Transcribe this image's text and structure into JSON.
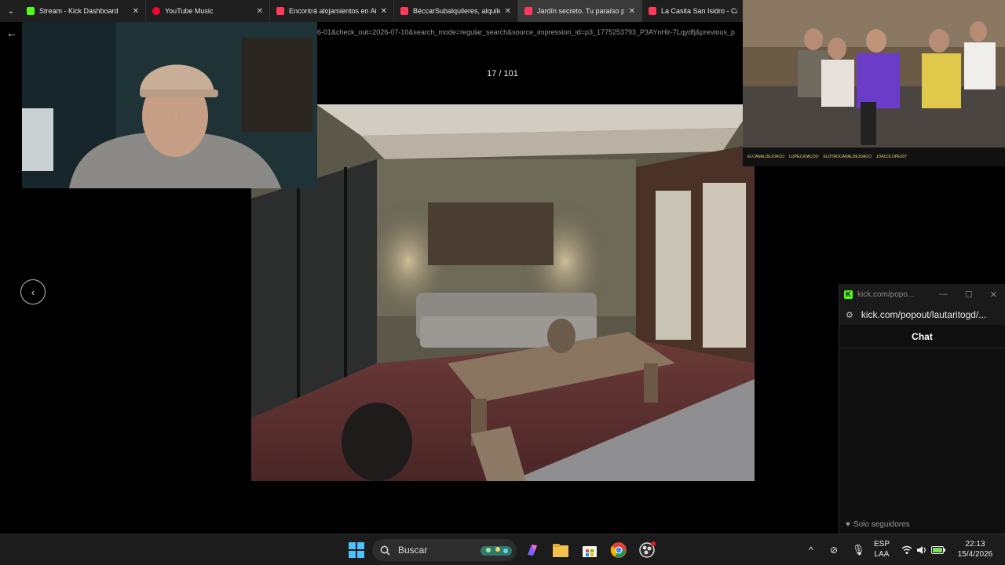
{
  "tabs": [
    {
      "title": "Stream - Kick Dashboard",
      "favicon_color": "#53fc18",
      "active": false
    },
    {
      "title": "YouTube Music",
      "favicon_color": "#ff0033",
      "active": false
    },
    {
      "title": "Encontrá alojamientos en Airbnb",
      "favicon_color": "#ff385c",
      "active": false
    },
    {
      "title": "BéccarSubalquileres, alquileres",
      "favicon_color": "#ff385c",
      "active": false
    },
    {
      "title": "Jardín secreto. Tu paraíso priva",
      "favicon_color": "#ff385c",
      "active": true
    },
    {
      "title": "La Casita San Isidro - Casas en",
      "favicon_color": "#ff385c",
      "active": false
    }
  ],
  "address": {
    "url_fragment": "6-01&check_out=2026-07-10&search_mode=regular_search&source_impression_id=p3_1775253793_P3AYnHlr-7Lqydfj&previous_p"
  },
  "gallery": {
    "counter": "17 / 101"
  },
  "stream_overlay": {
    "names": [
      "ELCANALDEJOACO",
      "LOPEZJOACOO",
      "ELOTROCANALDEJOACO",
      "JOACOLOPEZ07"
    ]
  },
  "popout": {
    "title": "kick.com/popo...",
    "url": "kick.com/popout/lautaritogd/...",
    "chat_label": "Chat",
    "followers_only": "Solo seguidores"
  },
  "taskbar": {
    "search_label": "Buscar",
    "lang_1": "ESP",
    "lang_2": "LAA",
    "time": "22:13",
    "date": "15/4/2026"
  }
}
